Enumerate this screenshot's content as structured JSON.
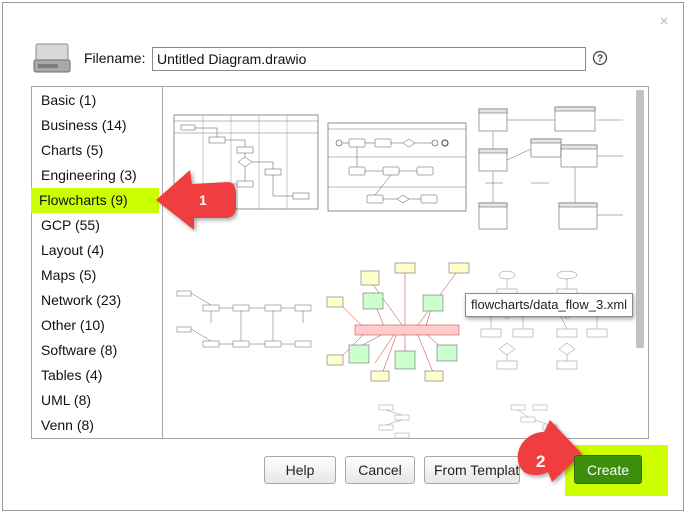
{
  "dialog": {
    "filename_label": "Filename:",
    "filename_value": "Untitled Diagram.drawio",
    "close_glyph": "×"
  },
  "categories": [
    {
      "label": "Basic (1)"
    },
    {
      "label": "Business (14)"
    },
    {
      "label": "Charts (5)"
    },
    {
      "label": "Engineering (3)"
    },
    {
      "label": "Flowcharts (9)",
      "selected": true
    },
    {
      "label": "GCP (55)"
    },
    {
      "label": "Layout (4)"
    },
    {
      "label": "Maps (5)"
    },
    {
      "label": "Network (23)"
    },
    {
      "label": "Other (10)"
    },
    {
      "label": "Software (8)"
    },
    {
      "label": "Tables (4)"
    },
    {
      "label": "UML (8)"
    },
    {
      "label": "Venn (8)"
    }
  ],
  "tooltip": "flowcharts/data_flow_3.xml",
  "buttons": {
    "help": "Help",
    "cancel": "Cancel",
    "from_template": "From Template",
    "create": "Create"
  },
  "annotations": {
    "marker_1": "1",
    "marker_2": "2"
  },
  "colors": {
    "highlight": "#ccff00",
    "create_button": "#3d8f0b",
    "marker": "#ef3d40"
  },
  "icons": [
    "drive-icon",
    "help-icon",
    "close-icon"
  ]
}
